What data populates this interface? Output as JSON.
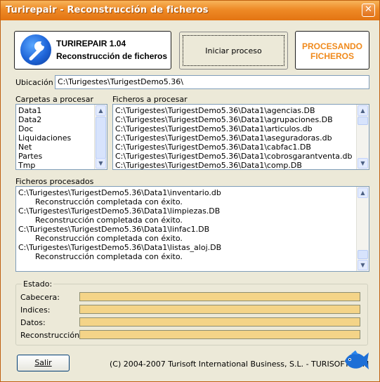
{
  "window": {
    "title": "Turirepair - Reconstrucción de ficheros",
    "close_glyph": "✕"
  },
  "header": {
    "app_name": "TURIREPAIR 1.04",
    "app_subtitle": "Reconstrucción de ficheros",
    "start_button": "Iniciar proceso",
    "status_line1": "PROCESANDO",
    "status_line2": "FICHEROS"
  },
  "location": {
    "label": "Ubicación",
    "value": "C:\\Turigestes\\TurigestDemo5.36\\"
  },
  "folders": {
    "label": "Carpetas a procesar",
    "items": [
      "Data1",
      "Data2",
      "Doc",
      "Liquidaciones",
      "Net",
      "Partes",
      "Tmp"
    ]
  },
  "files": {
    "label": "Ficheros a procesar",
    "items": [
      "C:\\Turigestes\\TurigestDemo5.36\\Data1\\agencias.DB",
      "C:\\Turigestes\\TurigestDemo5.36\\Data1\\agrupaciones.DB",
      "C:\\Turigestes\\TurigestDemo5.36\\Data1\\articulos.db",
      "C:\\Turigestes\\TurigestDemo5.36\\Data1\\aseguradoras.db",
      "C:\\Turigestes\\TurigestDemo5.36\\Data1\\cabfac1.DB",
      "C:\\Turigestes\\TurigestDemo5.36\\Data1\\cobrosgarantventa.db",
      "C:\\Turigestes\\TurigestDemo5.36\\Data1\\comp.DB"
    ]
  },
  "processed": {
    "label": "Ficheros procesados",
    "lines": [
      "C:\\Turigestes\\TurigestDemo5.36\\Data1\\inventario.db",
      "Reconstrucción completada con éxito.",
      "C:\\Turigestes\\TurigestDemo5.36\\Data1\\limpiezas.DB",
      "Reconstrucción completada con éxito.",
      "C:\\Turigestes\\TurigestDemo5.36\\Data1\\linfac1.DB",
      "Reconstrucción completada con éxito.",
      "C:\\Turigestes\\TurigestDemo5.36\\Data1\\listas_aloj.DB",
      "Reconstrucción completada con éxito."
    ]
  },
  "status": {
    "label": "Estado:",
    "rows": [
      {
        "label": "Cabecera:"
      },
      {
        "label": "Indices:"
      },
      {
        "label": "Datos:"
      },
      {
        "label": "Reconstrucción:"
      }
    ]
  },
  "footer": {
    "exit_button": "Salir",
    "copyright": "(C) 2004-2007 Turisoft International Business, S.L. - TURISOFT.COM"
  },
  "colors": {
    "title_bar": "#ee8a26",
    "status_text": "#f08a1c",
    "progress_fill": "#f4d488",
    "window_bg": "#ece9d8"
  },
  "icons": {
    "logo": "wrench-icon",
    "fish": "fish-logo-icon"
  }
}
